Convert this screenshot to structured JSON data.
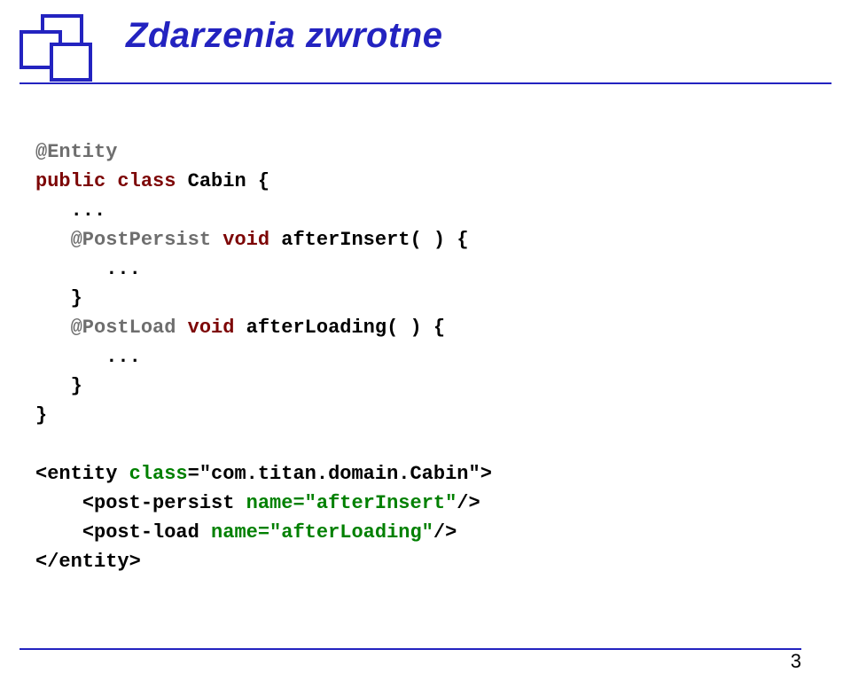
{
  "header": {
    "title": "Zdarzenia zwrotne"
  },
  "code": {
    "ann_entity": "@Entity",
    "kw_public": "public",
    "kw_class": "class",
    "classname": "Cabin",
    "brace_open": "{",
    "ellipsis1": "...",
    "ann_postpersist": "@PostPersist",
    "kw_void1": "void",
    "method1": "afterInsert",
    "parens": "( )",
    "brace_open2": "{",
    "ellipsis2": "...",
    "brace_close_inner": "}",
    "ann_postload": "@PostLoad",
    "kw_void2": "void",
    "method2": "afterLoading",
    "parens2": "( )",
    "brace_open3": "{",
    "ellipsis3": "...",
    "brace_close_inner2": "}",
    "brace_close_outer": "}",
    "xml_entity_open1": "<entity ",
    "xml_class_attr": "class",
    "xml_class_val": "=\"com.titan.domain.Cabin\">",
    "xml_pp_open": "<post-persist ",
    "xml_pp_name": "name=\"afterInsert\"",
    "xml_pp_close": "/>",
    "xml_pl_open": "<post-load ",
    "xml_pl_name": "name=\"afterLoading\"",
    "xml_pl_close": "/>",
    "xml_entity_close": "</entity>"
  },
  "pageNumber": "3",
  "colors": {
    "primary": "#2323c0",
    "keyword": "#7d0606",
    "annotation": "#6e6e6e",
    "attr": "#008000"
  }
}
